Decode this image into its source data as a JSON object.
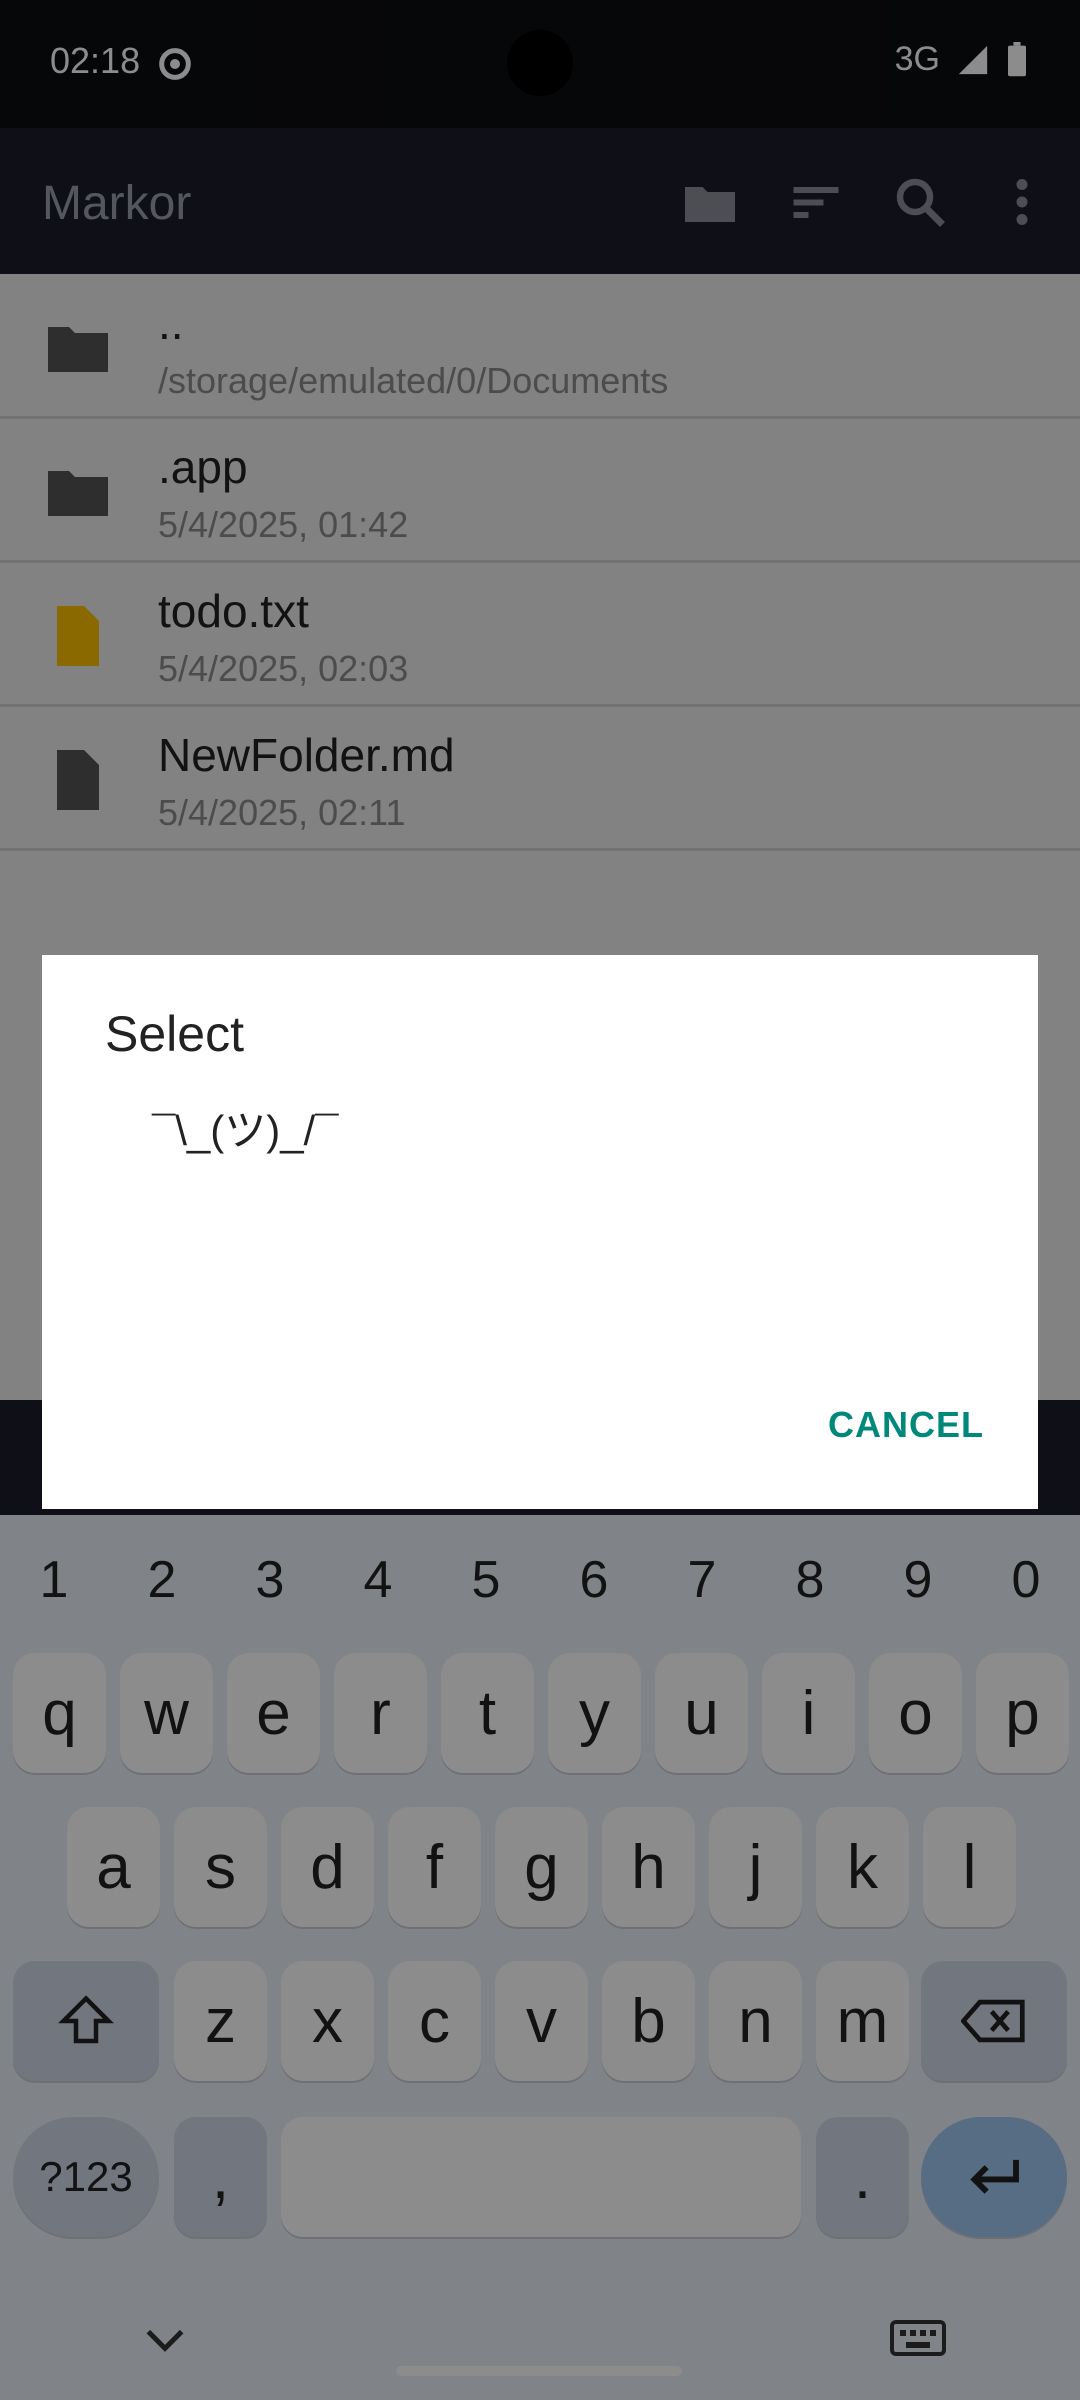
{
  "status_bar": {
    "time": "02:18",
    "network": "3G"
  },
  "app_bar": {
    "title": "Markor"
  },
  "files": [
    {
      "name": "..",
      "subtitle": "/storage/emulated/0/Documents",
      "icon": "folder-icon"
    },
    {
      "name": ".app",
      "subtitle": "5/4/2025, 01:42",
      "icon": "folder-icon"
    },
    {
      "name": "todo.txt",
      "subtitle": "5/4/2025, 02:03",
      "icon": "text-file-icon"
    },
    {
      "name": "NewFolder.md",
      "subtitle": "5/4/2025, 02:11",
      "icon": "file-icon"
    }
  ],
  "dialog": {
    "title": "Select",
    "empty_text": "¯\\_(ツ)_/¯",
    "cancel_label": "CANCEL"
  },
  "keyboard": {
    "numbers": [
      "1",
      "2",
      "3",
      "4",
      "5",
      "6",
      "7",
      "8",
      "9",
      "0"
    ],
    "row1": [
      "q",
      "w",
      "e",
      "r",
      "t",
      "y",
      "u",
      "i",
      "o",
      "p"
    ],
    "row2": [
      "a",
      "s",
      "d",
      "f",
      "g",
      "h",
      "j",
      "k",
      "l"
    ],
    "row3": [
      "z",
      "x",
      "c",
      "v",
      "b",
      "n",
      "m"
    ],
    "symbols_label": "?123",
    "comma": ",",
    "period": "."
  },
  "colors": {
    "accent": "#00897B",
    "file_yellow": "#F9C000"
  }
}
